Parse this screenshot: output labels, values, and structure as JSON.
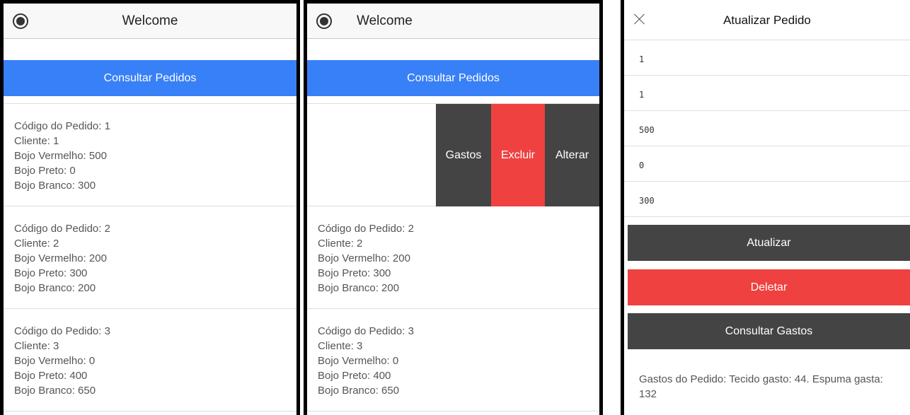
{
  "phone1": {
    "header": {
      "title": "Welcome",
      "logo_icon": "ionic-logo-icon"
    },
    "consult_button": "Consultar Pedidos",
    "orders": [
      {
        "codigo": "Código do Pedido: 1",
        "cliente": "Cliente: 1",
        "vermelho": "Bojo Vermelho: 500",
        "preto": "Bojo Preto: 0",
        "branco": "Bojo Branco: 300"
      },
      {
        "codigo": "Código do Pedido: 2",
        "cliente": "Cliente: 2",
        "vermelho": "Bojo Vermelho: 200",
        "preto": "Bojo Preto: 300",
        "branco": "Bojo Branco: 200"
      },
      {
        "codigo": "Código do Pedido: 3",
        "cliente": "Cliente: 3",
        "vermelho": "Bojo Vermelho: 0",
        "preto": "Bojo Preto: 400",
        "branco": "Bojo Branco: 650"
      }
    ]
  },
  "phone2": {
    "header": {
      "title": "Welcome",
      "logo_icon": "ionic-logo-icon"
    },
    "consult_button": "Consultar Pedidos",
    "swipe_options": {
      "gastos": "Gastos",
      "excluir": "Excluir",
      "alterar": "Alterar"
    },
    "orders": [
      {
        "codigo": "Código do Pedido: 2",
        "cliente": "Cliente: 2",
        "vermelho": "Bojo Vermelho: 200",
        "preto": "Bojo Preto: 300",
        "branco": "Bojo Branco: 200"
      },
      {
        "codigo": "Código do Pedido: 3",
        "cliente": "Cliente: 3",
        "vermelho": "Bojo Vermelho: 0",
        "preto": "Bojo Preto: 400",
        "branco": "Bojo Branco: 650"
      }
    ]
  },
  "phone3": {
    "header": {
      "title": "Atualizar Pedido",
      "close_icon": "close-icon"
    },
    "fields": [
      "1",
      "1",
      "500",
      "0",
      "300"
    ],
    "buttons": {
      "atualizar": "Atualizar",
      "deletar": "Deletar",
      "consultar_gastos": "Consultar Gastos"
    },
    "gastos_text": "Gastos do Pedido: Tecido gasto: 44. Espuma gasta: 132"
  },
  "colors": {
    "primary": "#3880f7",
    "danger": "#f04141",
    "dark": "#444444"
  }
}
